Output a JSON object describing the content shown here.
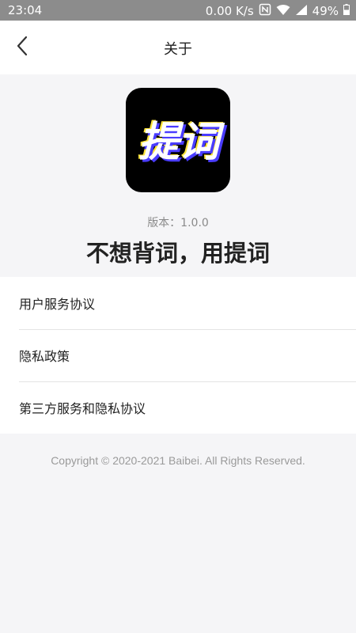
{
  "status_bar": {
    "time": "23:04",
    "net_speed": "0.00 K/s",
    "battery": "49%",
    "icons": [
      "nfc-icon",
      "wifi-icon",
      "signal-icon",
      "battery-icon"
    ]
  },
  "navbar": {
    "back_icon": "chevron-left-icon",
    "title": "关于"
  },
  "app": {
    "logo_text": "提词",
    "version": "版本：1.0.0",
    "slogan": "不想背词，用提词"
  },
  "menu": {
    "items": [
      {
        "label": "用户服务协议"
      },
      {
        "label": "隐私政策"
      },
      {
        "label": "第三方服务和隐私协议"
      }
    ]
  },
  "footer": {
    "copyright": "Copyright © 2020-2021 Baibei. All Rights Reserved."
  }
}
